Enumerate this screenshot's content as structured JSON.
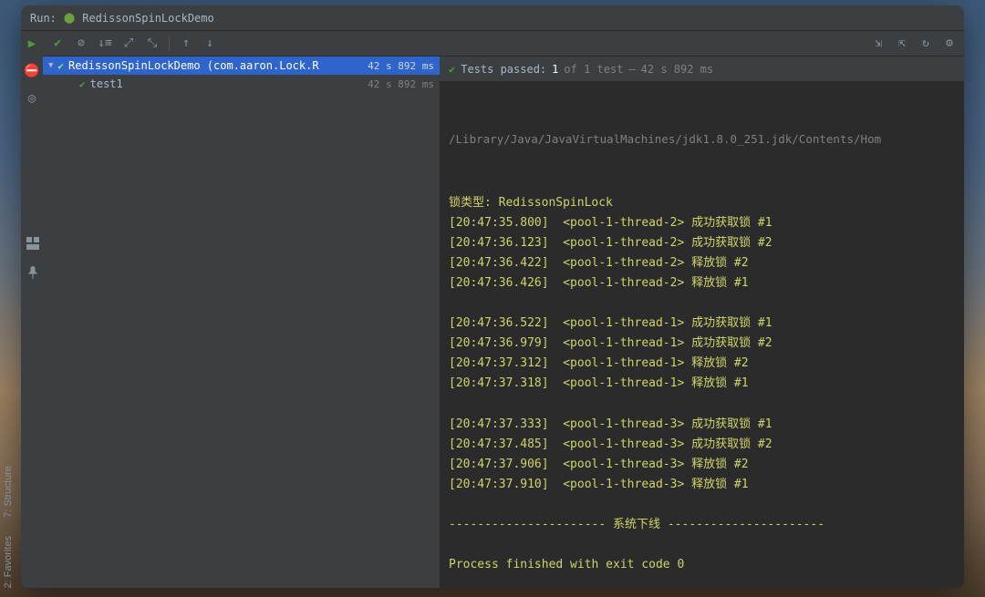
{
  "titlebar": {
    "run_label": "Run:",
    "tab_title": "RedissonSpinLockDemo"
  },
  "tree": {
    "root_name": "RedissonSpinLockDemo (com.aaron.Lock.R",
    "root_time": "42 s 892 ms",
    "child_name": "test1",
    "child_time": "42 s 892 ms"
  },
  "console_header": {
    "passed_label": "Tests passed:",
    "count": "1",
    "of_text": "of 1 test",
    "dash": "–",
    "time": "42 s 892 ms"
  },
  "console": {
    "path": "/Library/Java/JavaVirtualMachines/jdk1.8.0_251.jdk/Contents/Hom",
    "lines": [
      "锁类型: RedissonSpinLock",
      "[20:47:35.800]  <pool-1-thread-2> 成功获取锁 #1",
      "[20:47:36.123]  <pool-1-thread-2> 成功获取锁 #2",
      "[20:47:36.422]  <pool-1-thread-2> 释放锁 #2",
      "[20:47:36.426]  <pool-1-thread-2> 释放锁 #1",
      "",
      "[20:47:36.522]  <pool-1-thread-1> 成功获取锁 #1",
      "[20:47:36.979]  <pool-1-thread-1> 成功获取锁 #2",
      "[20:47:37.312]  <pool-1-thread-1> 释放锁 #2",
      "[20:47:37.318]  <pool-1-thread-1> 释放锁 #1",
      "",
      "[20:47:37.333]  <pool-1-thread-3> 成功获取锁 #1",
      "[20:47:37.485]  <pool-1-thread-3> 成功获取锁 #2",
      "[20:47:37.906]  <pool-1-thread-3> 释放锁 #2",
      "[20:47:37.910]  <pool-1-thread-3> 释放锁 #1",
      "",
      "---------------------- 系统下线 ----------------------",
      "",
      "Process finished with exit code 0"
    ]
  },
  "vertical_tabs": {
    "structure": "7: Structure",
    "favorites": "2: Favorites"
  }
}
